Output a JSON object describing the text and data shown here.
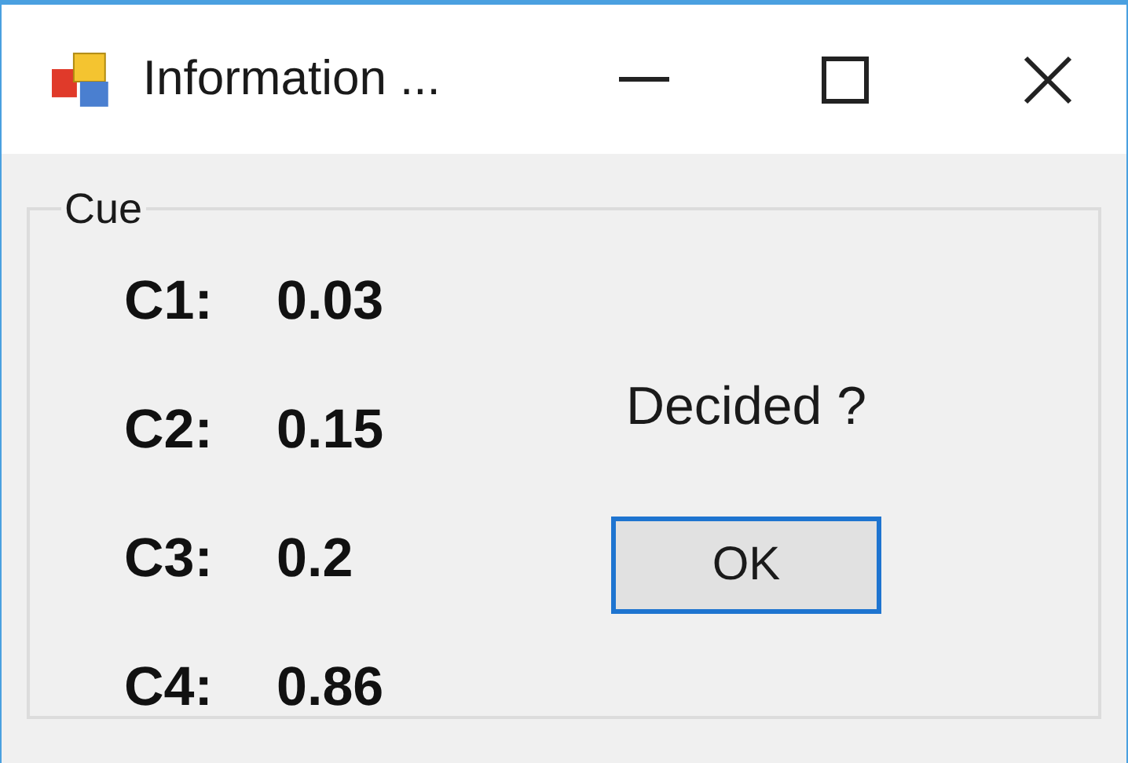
{
  "window": {
    "title": "Information ..."
  },
  "group": {
    "title": "Cue",
    "rows": [
      {
        "label": "C1:",
        "value": "0.03"
      },
      {
        "label": "C2:",
        "value": "0.15"
      },
      {
        "label": "C3:",
        "value": "0.2"
      },
      {
        "label": "C4:",
        "value": "0.86"
      }
    ]
  },
  "prompt": "Decided ?",
  "button": "OK"
}
